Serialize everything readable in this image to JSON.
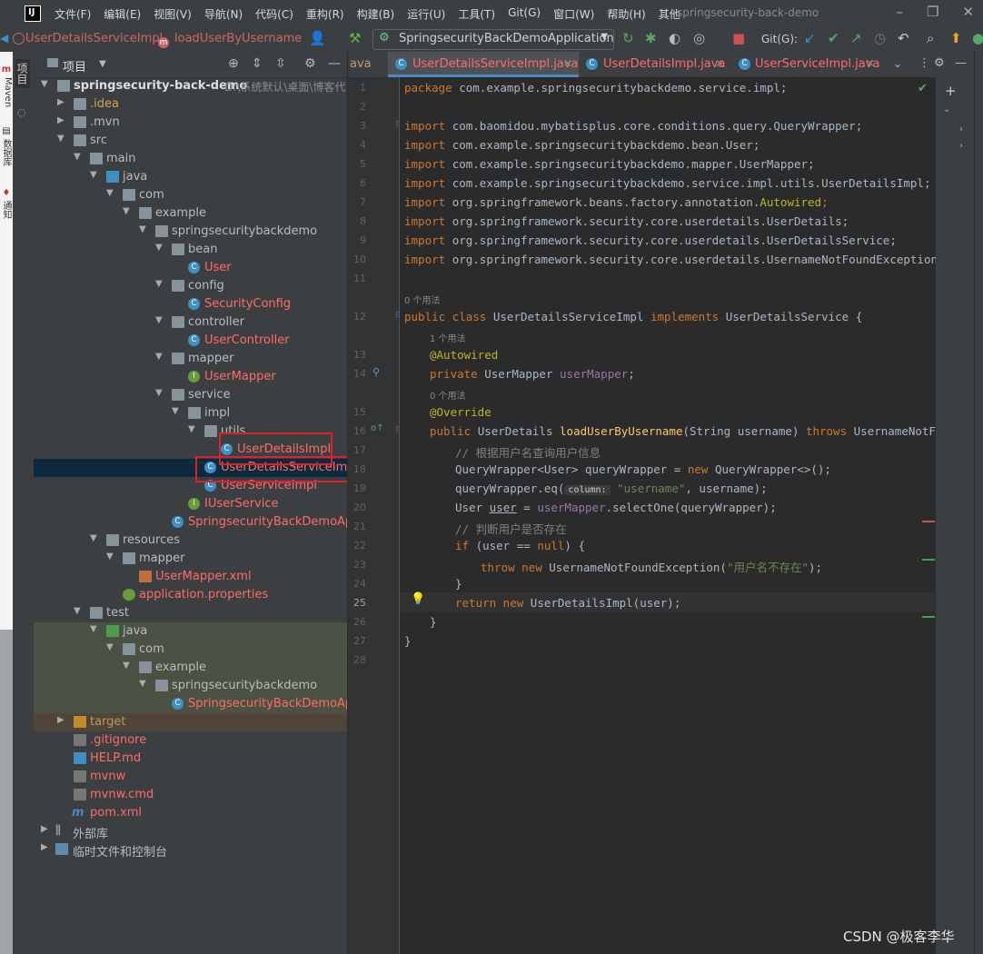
{
  "menubar": {
    "items": [
      "文件(F)",
      "编辑(E)",
      "视图(V)",
      "导航(N)",
      "代码(C)",
      "重构(R)",
      "构建(B)",
      "运行(U)",
      "工具(T)",
      "Git(G)",
      "窗口(W)",
      "帮助(H)",
      "其他"
    ],
    "window_title": "springsecurity-back-demo"
  },
  "toolbar": {
    "breadcrumb_class": "UserDetailsServiceImpl",
    "breadcrumb_method": "loadUserByUsername",
    "run_config": "SpringsecurityBackDemoApplication",
    "git_label": "Git(G):"
  },
  "left_strip": {
    "maven": "Maven",
    "db": "数据库",
    "notify": "通知"
  },
  "stripe": {
    "project_label": "项目"
  },
  "project": {
    "title": "项目",
    "root_name": "springsecurity-back-demo",
    "root_path": "D:\\系统默认\\桌面\\博客代",
    "nodes": {
      "idea": ".idea",
      "mvn": ".mvn",
      "src": "src",
      "main": "main",
      "java": "java",
      "com": "com",
      "example": "example",
      "pkg": "springsecuritybackdemo",
      "bean": "bean",
      "user": "User",
      "config": "config",
      "security_config": "SecurityConfig",
      "controller": "controller",
      "user_controller": "UserController",
      "mapper": "mapper",
      "user_mapper": "UserMapper",
      "service": "service",
      "impl": "impl",
      "utils": "utils",
      "user_details_impl": "UserDetailsImpl",
      "user_details_service_impl": "UserDetailsServiceImpl",
      "user_service_impl": "UserServiceImpl",
      "iuser_service": "IUserService",
      "app": "SpringsecurityBackDemoAppli",
      "resources": "resources",
      "res_mapper": "mapper",
      "user_mapper_xml": "UserMapper.xml",
      "app_props": "application.properties",
      "test": "test",
      "test_java": "java",
      "test_com": "com",
      "test_example": "example",
      "test_pkg": "springsecuritybackdemo",
      "test_app": "SpringsecurityBackDemoAppli",
      "target": "target",
      "gitignore": ".gitignore",
      "help": "HELP.md",
      "mvnw": "mvnw",
      "mvnw_cmd": "mvnw.cmd",
      "pom": "pom.xml",
      "ext_libs": "外部库",
      "scratches": "临时文件和控制台"
    }
  },
  "tabs": [
    {
      "label": "ava",
      "partial": true
    },
    {
      "label": "UserDetailsServiceImpl.java",
      "active": true
    },
    {
      "label": "UserDetailsImpl.java"
    },
    {
      "label": "UserServiceImpl.java"
    }
  ],
  "code": {
    "line_numbers": [
      "1",
      "2",
      "3",
      "4",
      "5",
      "6",
      "7",
      "8",
      "9",
      "10",
      "11",
      "12",
      "13",
      "14",
      "15",
      "16",
      "17",
      "18",
      "19",
      "20",
      "21",
      "22",
      "23",
      "24",
      "25",
      "26",
      "27",
      "28"
    ],
    "pkg": "com.example.springsecuritybackdemo.service.impl;",
    "imports": [
      "com.baomidou.mybatisplus.core.conditions.query.QueryWrapper;",
      "com.example.springsecuritybackdemo.bean.User;",
      "com.example.springsecuritybackdemo.mapper.UserMapper;",
      "com.example.springsecuritybackdemo.service.impl.utils.UserDetailsImpl;",
      "org.springframework.beans.factory.annotation.",
      "org.springframework.security.core.userdetails.UserDetails;",
      "org.springframework.security.core.userdetails.UserDetailsService;",
      "org.springframework.security.core.userdetails.UsernameNotFoundException;"
    ],
    "autowired_import": "Autowired",
    "hint_0_usage": "0 个用法",
    "hint_1_usage": "1 个用法",
    "class_name": "UserDetailsServiceImpl",
    "iface": "UserDetailsService",
    "ann_autowired": "@Autowired",
    "field_type": "UserMapper",
    "field_name": "userMapper",
    "ann_override": "@Override",
    "ret_type": "UserDetails",
    "method": "loadUserByUsername",
    "sig_rest": "(String username) ",
    "throws_type": "UsernameNotFoundEx",
    "comment1": "// 根据用户名查询用户信息",
    "qw_decl": "QueryWrapper<User> queryWrapper = ",
    "qw_new": "QueryWrapper<>();",
    "eq_call": "queryWrapper.eq(",
    "param_hint": "column:",
    "eq_str": "\"username\"",
    "eq_rest": ", username);",
    "user_decl": "User ",
    "user_var": "user",
    "select_call": ".selectOne(queryWrapper);",
    "comment2": "// 判断用户是否存在",
    "if_cond": "(user == ",
    "if_null": "null",
    "if_end": ") {",
    "throw_type": "UsernameNotFoundException(",
    "throw_msg": "\"用户名不存在\"",
    "throw_end": ");",
    "ret_new": "UserDetailsImpl(user);"
  },
  "watermark": "CSDN @极客李华"
}
